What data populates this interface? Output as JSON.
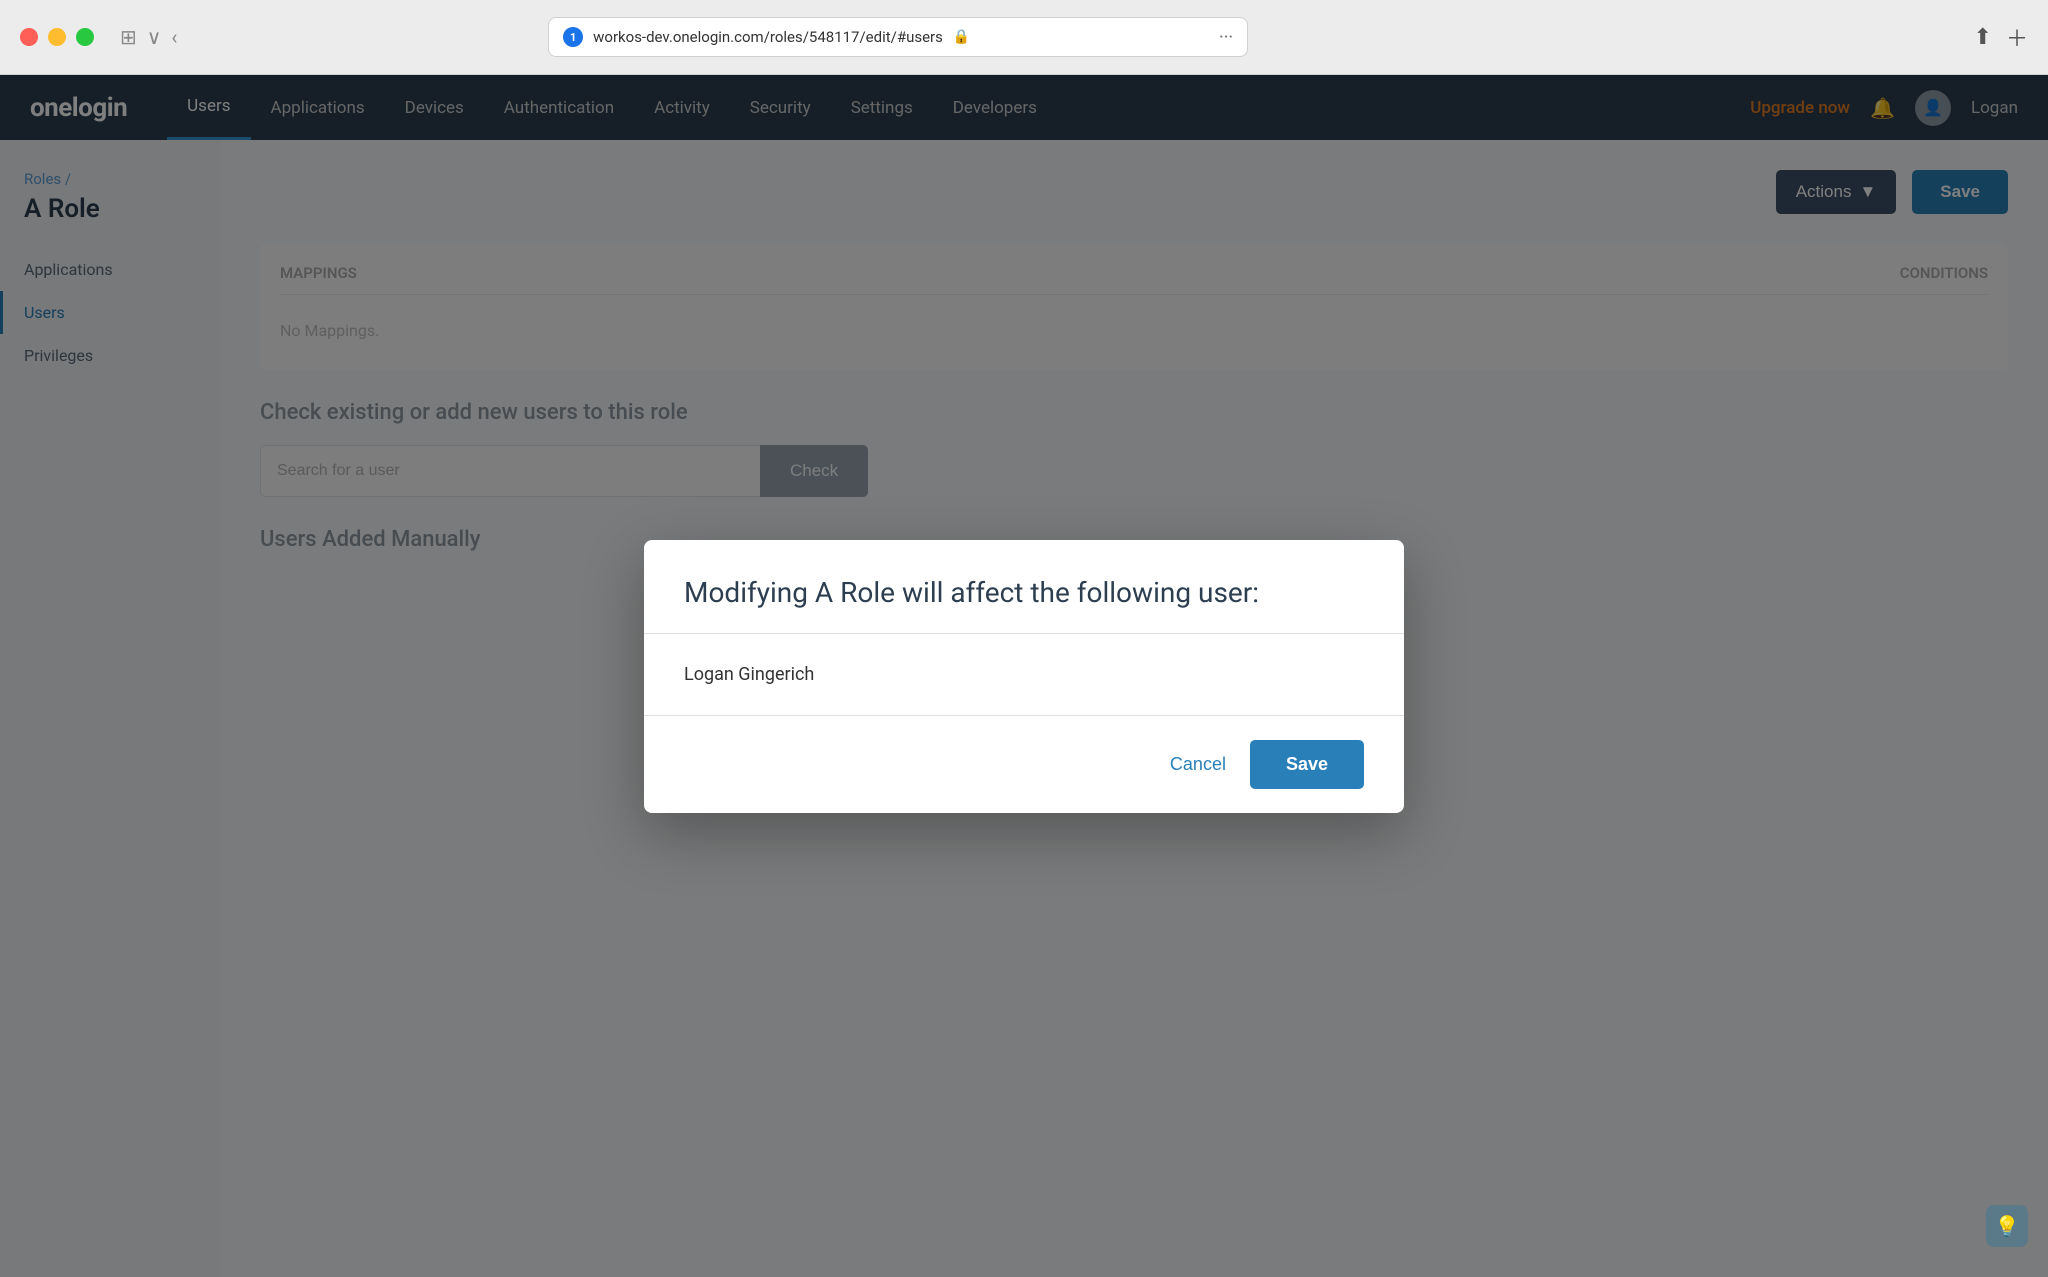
{
  "browser": {
    "tab_number": "1",
    "url": "workos-dev.onelogin.com/roles/548117/edit/#users",
    "back_label": "‹",
    "sidebar_label": "⊞",
    "more_label": "···"
  },
  "nav": {
    "logo": "onelogin",
    "items": [
      {
        "label": "Users",
        "active": true
      },
      {
        "label": "Applications",
        "active": false
      },
      {
        "label": "Devices",
        "active": false
      },
      {
        "label": "Authentication",
        "active": false
      },
      {
        "label": "Activity",
        "active": false
      },
      {
        "label": "Security",
        "active": false
      },
      {
        "label": "Settings",
        "active": false
      },
      {
        "label": "Developers",
        "active": false
      }
    ],
    "upgrade_label": "Upgrade now",
    "username": "Logan"
  },
  "sidebar": {
    "breadcrumb": "Roles /",
    "page_title": "A Role",
    "items": [
      {
        "label": "Applications",
        "active": false
      },
      {
        "label": "Users",
        "active": true
      },
      {
        "label": "Privileges",
        "active": false
      }
    ]
  },
  "content": {
    "actions_label": "Actions",
    "actions_chevron": "▼",
    "save_label": "Save",
    "mappings": {
      "col1": "Mappings",
      "col2": "Conditions",
      "no_mappings": "No Mappings."
    },
    "check_users": {
      "title": "Check existing or add new users to this role",
      "search_placeholder": "Search for a user",
      "check_label": "Check"
    },
    "users_added": {
      "title": "Users Added Manually"
    }
  },
  "modal": {
    "title": "Modifying A Role will affect the following user:",
    "user_name": "Logan Gingerich",
    "cancel_label": "Cancel",
    "save_label": "Save"
  },
  "help": {
    "icon": "💡"
  }
}
